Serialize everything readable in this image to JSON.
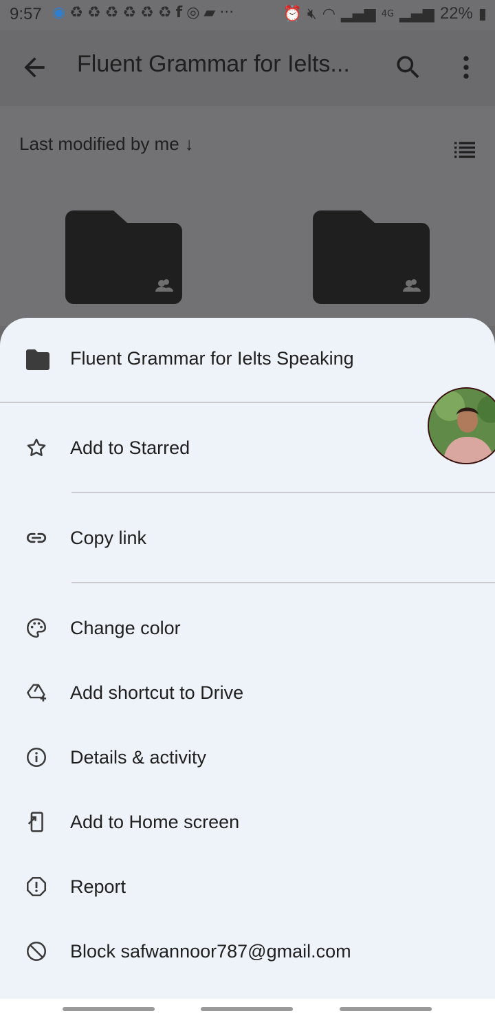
{
  "status_bar": {
    "time": "9:57",
    "notification_icons": [
      "messenger-icon",
      "recycle-icon",
      "recycle-icon",
      "recycle-icon",
      "recycle-icon",
      "recycle-icon",
      "recycle-icon",
      "facebook-icon",
      "app-icon",
      "message-icon"
    ],
    "more_label": "···",
    "network_label": "4G",
    "battery": "22%"
  },
  "app_bar": {
    "title": "Fluent Grammar for Ielts..."
  },
  "sort_bar": {
    "label": "Last modified by me",
    "arrow": "↓"
  },
  "sheet": {
    "header_title": "Fluent Grammar for Ielts Speaking",
    "items": [
      {
        "label": "Add to Starred",
        "icon": "star-outline-icon"
      },
      {
        "label": "Copy link",
        "icon": "link-icon"
      },
      {
        "label": "Change color",
        "icon": "palette-icon"
      },
      {
        "label": "Add shortcut to Drive",
        "icon": "drive-add-icon"
      },
      {
        "label": "Details & activity",
        "icon": "info-icon"
      },
      {
        "label": "Add to Home screen",
        "icon": "add-to-home-icon"
      },
      {
        "label": "Report",
        "icon": "report-icon"
      },
      {
        "label": "Block safwannoor787@gmail.com",
        "icon": "block-icon"
      }
    ]
  },
  "colors": {
    "sheet_background": "#eef2f9",
    "scrim": "#6b6b6d",
    "text": "#1f1f1f",
    "folder": "#1f1f1f"
  }
}
